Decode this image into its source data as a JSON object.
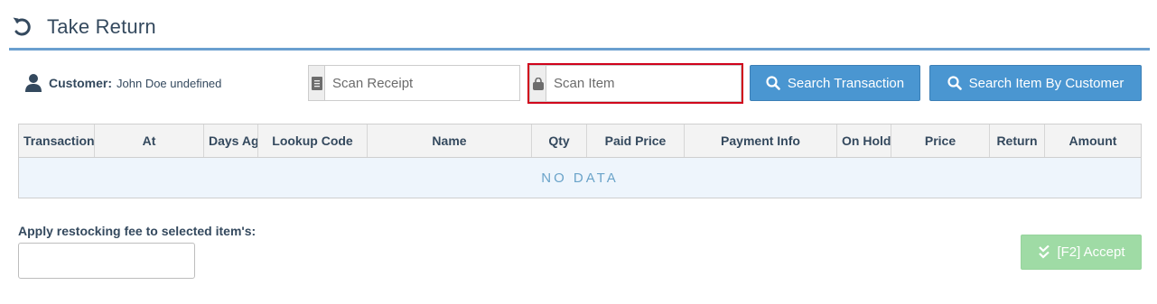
{
  "header": {
    "title": "Take Return",
    "icon": "undo-icon"
  },
  "customer": {
    "label": "Customer:",
    "name": "John Doe undefined"
  },
  "scan_receipt": {
    "placeholder": "Scan Receipt",
    "value": ""
  },
  "scan_item": {
    "placeholder": "Scan Item",
    "value": ""
  },
  "buttons": {
    "search_transaction": "Search Transaction",
    "search_item_by_customer": "Search Item By Customer",
    "accept": "[F2] Accept"
  },
  "grid": {
    "columns": [
      "Transaction",
      "At",
      "Days Ago",
      "Lookup Code",
      "Name",
      "Qty",
      "Paid Price",
      "Payment Info",
      "On Hold",
      "Price",
      "Return",
      "Amount"
    ],
    "empty_text": "NO DATA"
  },
  "restocking": {
    "label": "Apply restocking fee to selected item's:",
    "value": ""
  },
  "colors": {
    "primary": "#4a96d1",
    "accent_border": "#d0021b",
    "accept_disabled": "#9fdba5",
    "header_rule": "#6a9fcf"
  }
}
